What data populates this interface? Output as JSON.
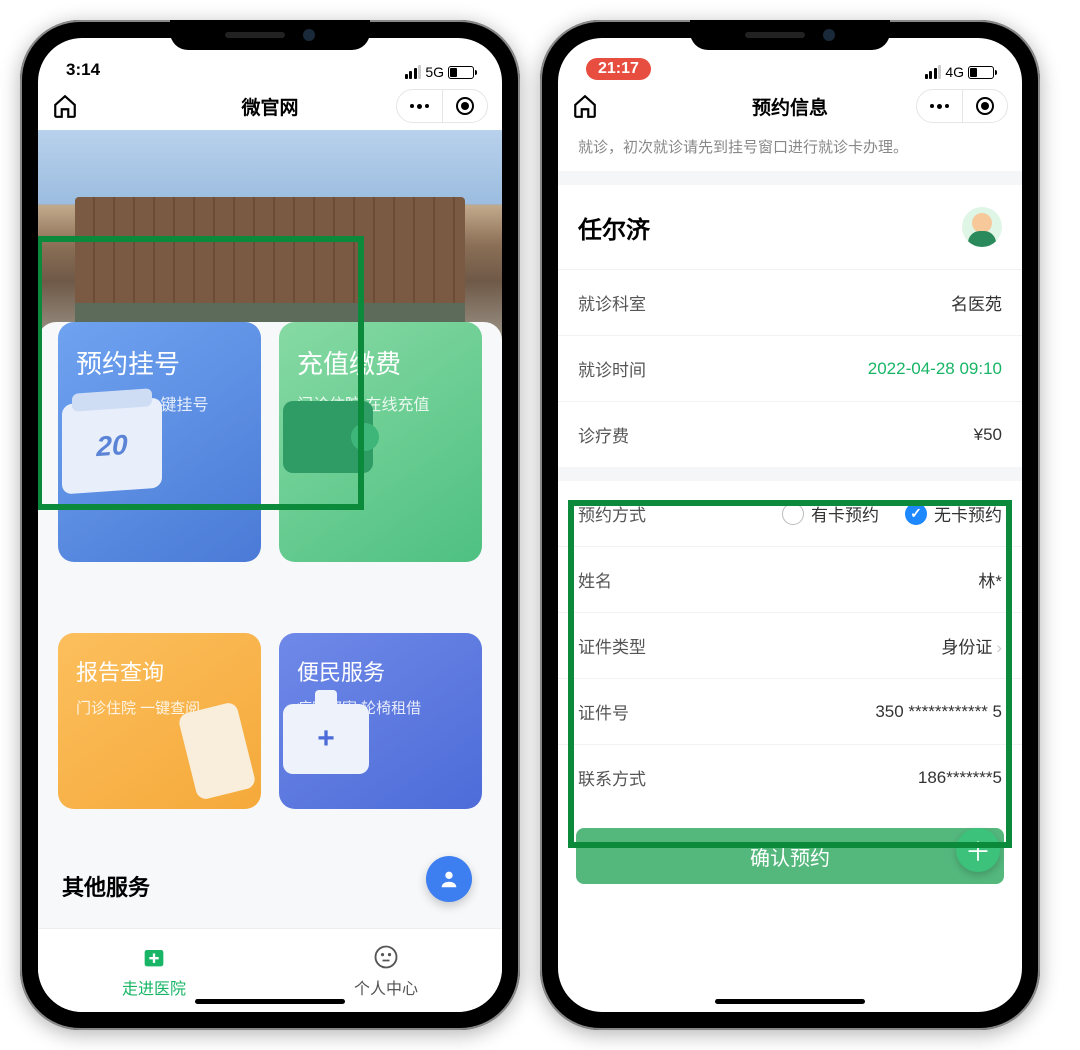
{
  "left": {
    "status": {
      "time": "3:14",
      "net": "5G"
    },
    "nav_title": "微官网",
    "cards": {
      "appointment": {
        "title": "预约挂号",
        "sub": "便捷预约 一键挂号",
        "day": "20"
      },
      "payment": {
        "title": "充值缴费",
        "sub": "门诊住院 在线充值"
      },
      "report": {
        "title": "报告查询",
        "sub": "门诊住院 一键查阅"
      },
      "service": {
        "title": "便民服务",
        "sub": "病案邮寄 轮椅租借"
      }
    },
    "other_title": "其他服务",
    "tabs": {
      "enter": "走进医院",
      "profile": "个人中心"
    }
  },
  "right": {
    "status": {
      "time": "21:17",
      "net": "4G"
    },
    "nav_title": "预约信息",
    "notice": "就诊，初次就诊请先到挂号窗口进行就诊卡办理。",
    "patient_name": "任尔济",
    "info": {
      "dept_k": "就诊科室",
      "dept_v": "名医苑",
      "time_k": "就诊时间",
      "time_v": "2022-04-28 09:10",
      "fee_k": "诊疗费",
      "fee_v": "¥50"
    },
    "form": {
      "method_k": "预约方式",
      "method_card": "有卡预约",
      "method_nocard": "无卡预约",
      "name_k": "姓名",
      "name_v": "林*",
      "idtype_k": "证件类型",
      "idtype_v": "身份证",
      "idnum_k": "证件号",
      "idnum_v": "350 ************ 5",
      "phone_k": "联系方式",
      "phone_v": "186*******5"
    },
    "confirm": "确认预约"
  }
}
